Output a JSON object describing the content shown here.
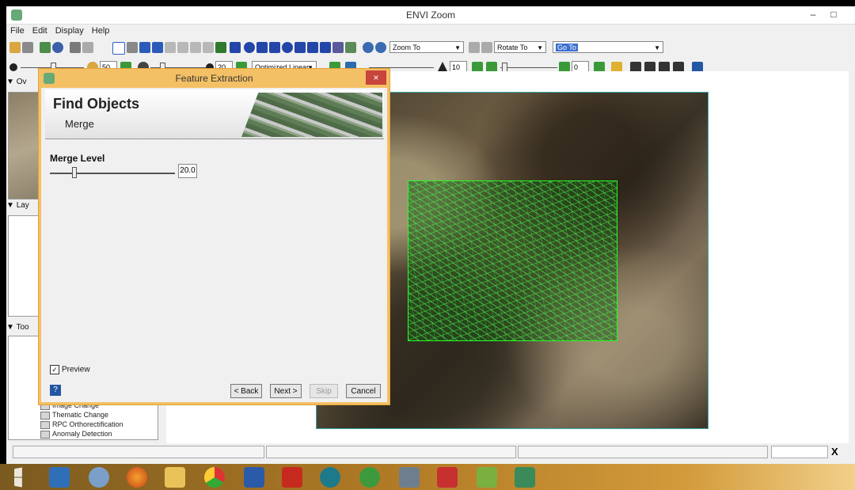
{
  "app": {
    "title": "ENVI Zoom"
  },
  "window_controls": {
    "minimize": "–",
    "restore": "□",
    "close": "×"
  },
  "menu": [
    "File",
    "Edit",
    "Display",
    "Help"
  ],
  "toolbar1": {
    "zoom_select": "Zoom To",
    "rotate_select": "Rotate To",
    "goto_select": "Go To"
  },
  "toolbar2": {
    "brightness": "50",
    "contrast": "20",
    "stretch_select": "Optimized Linear",
    "sharpen": "10",
    "transparency": "0"
  },
  "left_panel": {
    "overview_header": "Ov",
    "layers_header": "Lay",
    "toolbox_header": "Too",
    "tools": [
      "Image Change",
      "Thematic Change",
      "RPC Orthorectification",
      "Anomaly Detection"
    ]
  },
  "dialog": {
    "title": "Feature Extraction",
    "heading": "Find Objects",
    "subheading": "Merge",
    "merge_label": "Merge Level",
    "merge_value": "20.0",
    "merge_level_fraction": 0.2,
    "preview_label": "Preview",
    "preview_checked": true,
    "help_icon": "?",
    "buttons": {
      "back": "< Back",
      "next": "Next >",
      "skip": "Skip",
      "cancel": "Cancel"
    }
  },
  "statusbar": {
    "close_glyph": "X"
  },
  "colors": {
    "dialog_border": "#f4c065",
    "segmentation": "#33ff33",
    "close_red": "#c8453c"
  },
  "taskbar_icons": [
    "windows-start-icon",
    "explorer-icon",
    "paint-icon",
    "firefox-icon",
    "file-manager-icon",
    "chrome-icon",
    "word-icon",
    "acrobat-icon",
    "envi-search-icon",
    "globe-icon",
    "drive-icon",
    "pen-icon",
    "chart-icon",
    "envi-icon"
  ]
}
